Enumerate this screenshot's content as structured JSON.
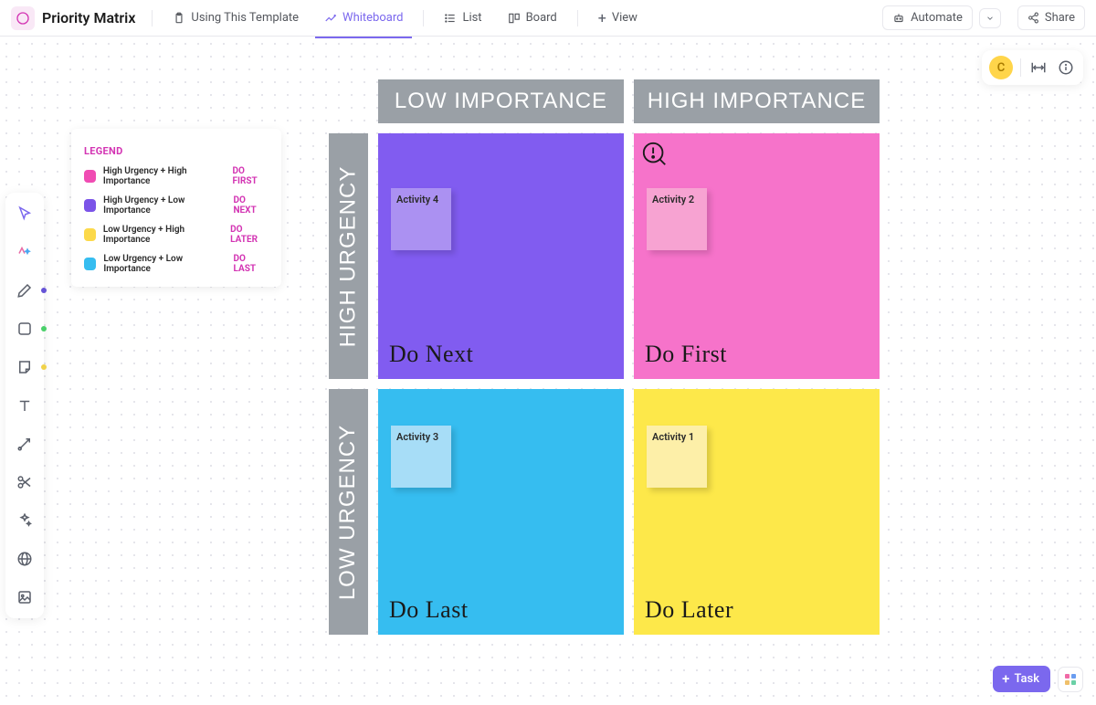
{
  "header": {
    "title": "Priority Matrix",
    "tabs": {
      "template": "Using This Template",
      "whiteboard": "Whiteboard",
      "list": "List",
      "board": "Board",
      "view": "View"
    },
    "automate": "Automate",
    "share": "Share"
  },
  "avatar": {
    "initial": "C"
  },
  "legend": {
    "title": "LEGEND",
    "items": [
      {
        "label": "High Urgency + High Importance",
        "action": "DO FIRST",
        "color": "#f04cb3"
      },
      {
        "label": "High Urgency + Low Importance",
        "action": "DO NEXT",
        "color": "#7b54e8"
      },
      {
        "label": "Low Urgency + High Importance",
        "action": "DO LATER",
        "color": "#fcd94a"
      },
      {
        "label": "Low Urgency + Low Importance",
        "action": "DO LAST",
        "color": "#36bdf0"
      }
    ]
  },
  "matrix": {
    "colHeaders": [
      "LOW IMPORTANCE",
      "HIGH IMPORTANCE"
    ],
    "rowHeaders": [
      "HIGH URGENCY",
      "LOW URGENCY"
    ],
    "quads": {
      "topLeft": {
        "note": "Activity 4",
        "label": "Do Next"
      },
      "topRight": {
        "note": "Activity 2",
        "label": "Do First"
      },
      "botLeft": {
        "note": "Activity 3",
        "label": "Do Last"
      },
      "botRight": {
        "note": "Activity 1",
        "label": "Do Later"
      }
    }
  },
  "taskBtn": "Task"
}
